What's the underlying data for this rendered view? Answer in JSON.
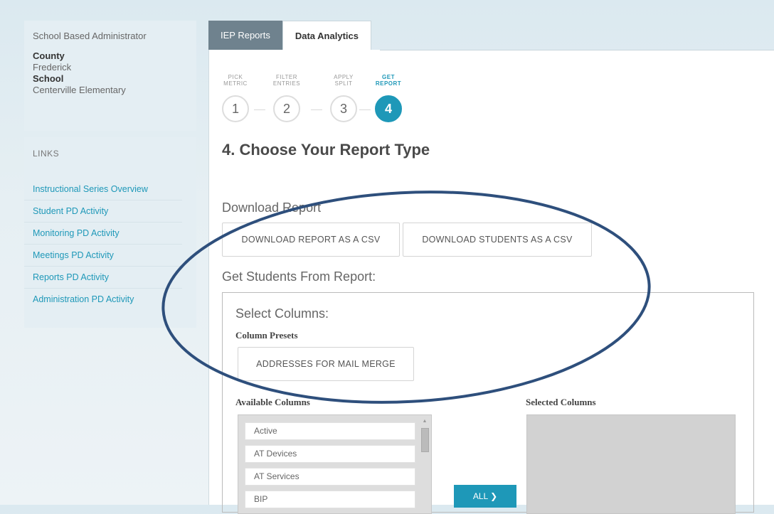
{
  "user_panel": {
    "role": "School Based Administrator",
    "county_label": "County",
    "county_value": "Frederick",
    "school_label": "School",
    "school_value": "Centerville Elementary"
  },
  "links": {
    "heading": "LINKS",
    "items": [
      "Instructional Series Overview",
      "Student PD Activity",
      "Monitoring PD Activity",
      "Meetings PD Activity",
      "Reports PD Activity",
      "Administration PD Activity"
    ]
  },
  "tabs": [
    {
      "label": "IEP Reports",
      "active": false
    },
    {
      "label": "Data Analytics",
      "active": true
    }
  ],
  "steps": [
    {
      "label_line1": "PICK",
      "label_line2": "METRIC",
      "number": "1",
      "active": false
    },
    {
      "label_line1": "FILTER",
      "label_line2": "ENTRIES",
      "number": "2",
      "active": false
    },
    {
      "label_line1": "APPLY",
      "label_line2": "SPLIT",
      "number": "3",
      "active": false
    },
    {
      "label_line1": "GET",
      "label_line2": "REPORT",
      "number": "4",
      "active": true
    }
  ],
  "main": {
    "title": "4. Choose Your Report Type",
    "download_heading": "Download Report",
    "download_report_csv": "DOWNLOAD REPORT AS A CSV",
    "download_students_csv": "DOWNLOAD STUDENTS AS A CSV",
    "students_heading": "Get Students From Report:",
    "select_columns_heading": "Select Columns:",
    "column_presets_label": "Column Presets",
    "preset_mail_merge": "ADDRESSES FOR MAIL MERGE",
    "available_columns_label": "Available Columns",
    "selected_columns_label": "Selected Columns",
    "available_columns": [
      "Active",
      "AT Devices",
      "AT Services",
      "BIP"
    ],
    "all_button": "ALL",
    "all_button_icon": "chevron-right-icon"
  },
  "colors": {
    "accent": "#1e98b8",
    "tab_inactive": "#6f828e",
    "annotation_ellipse": "#2e4f7c"
  }
}
